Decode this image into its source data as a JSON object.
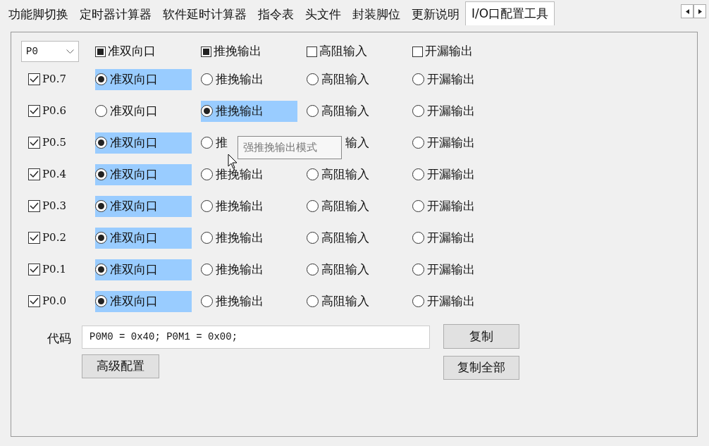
{
  "tabs": [
    {
      "label": "功能脚切换",
      "selected": false
    },
    {
      "label": "定时器计算器",
      "selected": false
    },
    {
      "label": "软件延时计算器",
      "selected": false
    },
    {
      "label": "指令表",
      "selected": false
    },
    {
      "label": "头文件",
      "selected": false
    },
    {
      "label": "封装脚位",
      "selected": false
    },
    {
      "label": "更新说明",
      "selected": false
    },
    {
      "label": "I/O口配置工具",
      "selected": true
    }
  ],
  "port_select": {
    "value": "P0"
  },
  "all_modes": [
    {
      "label": "准双向口",
      "checked": true
    },
    {
      "label": "推挽输出",
      "checked": true
    },
    {
      "label": "高阻输入",
      "checked": false
    },
    {
      "label": "开漏输出",
      "checked": false
    }
  ],
  "pins": [
    {
      "label": "P0.7",
      "checked": true,
      "options": [
        {
          "label": "准双向口",
          "selected": true
        },
        {
          "label": "推挽输出",
          "selected": false
        },
        {
          "label": "高阻输入",
          "selected": false
        },
        {
          "label": "开漏输出",
          "selected": false
        }
      ]
    },
    {
      "label": "P0.6",
      "checked": true,
      "options": [
        {
          "label": "准双向口",
          "selected": false
        },
        {
          "label": "推挽输出",
          "selected": true
        },
        {
          "label": "高阻输入",
          "selected": false
        },
        {
          "label": "开漏输出",
          "selected": false
        }
      ]
    },
    {
      "label": "P0.5",
      "checked": true,
      "options": [
        {
          "label": "准双向口",
          "selected": true
        },
        {
          "label": "推",
          "selected": false
        },
        {
          "label": "输入",
          "selected": false,
          "start_hidden": true
        },
        {
          "label": "开漏输出",
          "selected": false
        }
      ]
    },
    {
      "label": "P0.4",
      "checked": true,
      "options": [
        {
          "label": "准双向口",
          "selected": true
        },
        {
          "label": "推挽输出",
          "selected": false
        },
        {
          "label": "高阻输入",
          "selected": false
        },
        {
          "label": "开漏输出",
          "selected": false
        }
      ]
    },
    {
      "label": "P0.3",
      "checked": true,
      "options": [
        {
          "label": "准双向口",
          "selected": true
        },
        {
          "label": "推挽输出",
          "selected": false
        },
        {
          "label": "高阻输入",
          "selected": false
        },
        {
          "label": "开漏输出",
          "selected": false
        }
      ]
    },
    {
      "label": "P0.2",
      "checked": true,
      "options": [
        {
          "label": "准双向口",
          "selected": true
        },
        {
          "label": "推挽输出",
          "selected": false
        },
        {
          "label": "高阻输入",
          "selected": false
        },
        {
          "label": "开漏输出",
          "selected": false
        }
      ]
    },
    {
      "label": "P0.1",
      "checked": true,
      "options": [
        {
          "label": "准双向口",
          "selected": true
        },
        {
          "label": "推挽输出",
          "selected": false
        },
        {
          "label": "高阻输入",
          "selected": false
        },
        {
          "label": "开漏输出",
          "selected": false
        }
      ]
    },
    {
      "label": "P0.0",
      "checked": true,
      "options": [
        {
          "label": "准双向口",
          "selected": true
        },
        {
          "label": "推挽输出",
          "selected": false
        },
        {
          "label": "高阻输入",
          "selected": false
        },
        {
          "label": "开漏输出",
          "selected": false
        }
      ]
    }
  ],
  "code": {
    "label": "代码",
    "value": "P0M0 = 0x40; P0M1 = 0x00;"
  },
  "buttons": [
    {
      "label": "复制"
    },
    {
      "label": "高级配置"
    },
    {
      "label": "复制全部"
    }
  ],
  "tooltip": {
    "text": "强推挽输出模式"
  }
}
